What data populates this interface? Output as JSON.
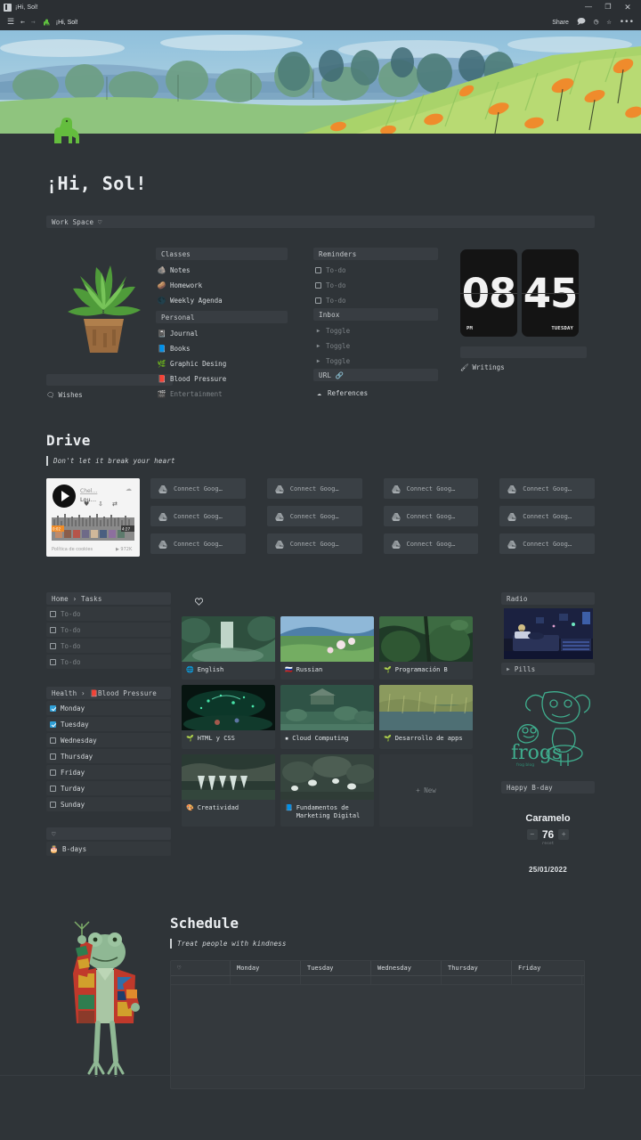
{
  "window": {
    "app_icon": "notion-icon",
    "title": "¡Hi, Sol!",
    "minimize": "—",
    "maximize": "❐",
    "close": "✕"
  },
  "nav": {
    "menu_icon": "hamburger-menu-icon",
    "back_icon": "←",
    "forward_icon": "→",
    "page_icon": "dinosaur-icon",
    "breadcrumb": "¡Hi, Sol!",
    "share_label": "Share",
    "comment_icon": "comment-icon",
    "history_icon": "clock-history-icon",
    "favorite_icon": "star-icon",
    "more_icon": "•••"
  },
  "page": {
    "title": "¡Hi, Sol!",
    "workspace_bar": "Work Space ♡"
  },
  "columns": {
    "plant": {
      "image": "potted-plant-pixel-art",
      "placeholder_bar": "",
      "wishes_icon": "speech-bubble-icon",
      "wishes_label": "Wishes"
    },
    "classes": {
      "header": "Classes",
      "items": [
        {
          "emoji": "🪨",
          "label": "Notes"
        },
        {
          "emoji": "🥔",
          "label": "Homework"
        },
        {
          "emoji": "🌑",
          "label": "Weekly Agenda"
        }
      ],
      "personal_header": "Personal",
      "personal_items": [
        {
          "emoji": "📓",
          "label": "Journal"
        },
        {
          "emoji": "📘",
          "label": "Books"
        },
        {
          "emoji": "🌿",
          "label": "Graphic Desing"
        },
        {
          "emoji": "📕",
          "label": "Blood Pressure"
        },
        {
          "emoji": "🎬",
          "label": "Entertainment"
        }
      ]
    },
    "reminders": {
      "header": "Reminders",
      "todos": [
        "To-do",
        "To-do",
        "To-do"
      ],
      "inbox_header": "Inbox",
      "toggles": [
        "Toggle",
        "Toggle",
        "Toggle"
      ],
      "url_bar": "URL 🔗",
      "references_icon": "cloud-icon",
      "references_label": "References"
    },
    "clock": {
      "hour": "08",
      "minute": "45",
      "meridiem": "PM",
      "weekday": "TUESDAY",
      "placeholder_bar": "",
      "writings_icon": "feather-icon",
      "writings_label": "Writings"
    }
  },
  "drive": {
    "title": "Drive",
    "quote": "Don't let it break your heart",
    "player": {
      "play_icon": "play-button-icon",
      "track_artist": "Chel…",
      "track_title": "Lou…",
      "like_icon": "heart-icon",
      "share_icon": "share-icon",
      "repost_icon": "repost-icon",
      "cloud_icon": "soundcloud-icon",
      "time_current": "0:02",
      "time_total": "4:27",
      "cookies_label": "Política de cookies",
      "plays": "972K"
    },
    "cards": [
      "Connect Goog…",
      "Connect Goog…",
      "Connect Goog…",
      "Connect Goog…",
      "Connect Goog…",
      "Connect Goog…",
      "Connect Goog…",
      "Connect Goog…",
      "Connect Goog…",
      "Connect Goog…",
      "Connect Goog…",
      "Connect Goog…"
    ],
    "card_icon": "google-drive-icon"
  },
  "tasks": {
    "header": "Home › Tasks",
    "items": [
      "To-do",
      "To-do",
      "To-do",
      "To-do"
    ]
  },
  "health": {
    "header": "Health › 📕Blood Pressure",
    "days": [
      {
        "label": "Monday",
        "checked": true
      },
      {
        "label": "Tuesday",
        "checked": true
      },
      {
        "label": "Wednesday",
        "checked": false
      },
      {
        "label": "Thursday",
        "checked": false
      },
      {
        "label": "Friday",
        "checked": false
      },
      {
        "label": "Turday",
        "checked": false
      },
      {
        "label": "Sunday",
        "checked": false
      }
    ]
  },
  "bdays": {
    "header_icon": "♡",
    "emoji": "🎂",
    "label": "B-days"
  },
  "courses": {
    "divider_icon": "heart-icon",
    "items": [
      {
        "emoji": "🌐",
        "label": "English",
        "thumb": "waterfall"
      },
      {
        "emoji": "🇷🇺",
        "label": "Russian",
        "thumb": "meadow"
      },
      {
        "emoji": "🌱",
        "label": "Programación B",
        "thumb": "vines"
      },
      {
        "emoji": "🌱",
        "label": "HTML y CSS",
        "thumb": "bioluminescent"
      },
      {
        "emoji": "▫",
        "label": "Cloud Computing",
        "thumb": "garden"
      },
      {
        "emoji": "🌱",
        "label": "Desarrollo de apps",
        "thumb": "reeds"
      },
      {
        "emoji": "🎨",
        "label": "Creatividad",
        "thumb": "rocks"
      },
      {
        "emoji": "📘",
        "label": "Fundamentos de Marketing Digital",
        "thumb": "stones"
      }
    ],
    "new_label": "+ New"
  },
  "sidebar_right": {
    "radio_header": "Radio",
    "radio_image": "lofi-bedroom",
    "pills_toggle": "Pills",
    "frogs_art": "frogs-illustration",
    "frogs_text": "frogs",
    "bday_bar": "Happy B-day",
    "counter_title": "Caramelo",
    "counter_minus": "−",
    "counter_value": "76",
    "counter_plus": "+",
    "counter_reset": "reset",
    "date": "25/01/2022"
  },
  "schedule": {
    "illustration": "frog-in-jacket",
    "title": "Schedule",
    "quote": "Treat people with kindness",
    "columns": [
      "♡",
      "Monday",
      "Tuesday",
      "Wednesday",
      "Thursday",
      "Friday"
    ],
    "rows": []
  },
  "colors": {
    "background": "#2f3438",
    "bar": "#383d42",
    "card": "#343a3e",
    "accent_blue": "#2f9fd6",
    "text": "#d5d9dc",
    "text_dim": "#7d8387",
    "frog_green": "#3fae8e"
  }
}
